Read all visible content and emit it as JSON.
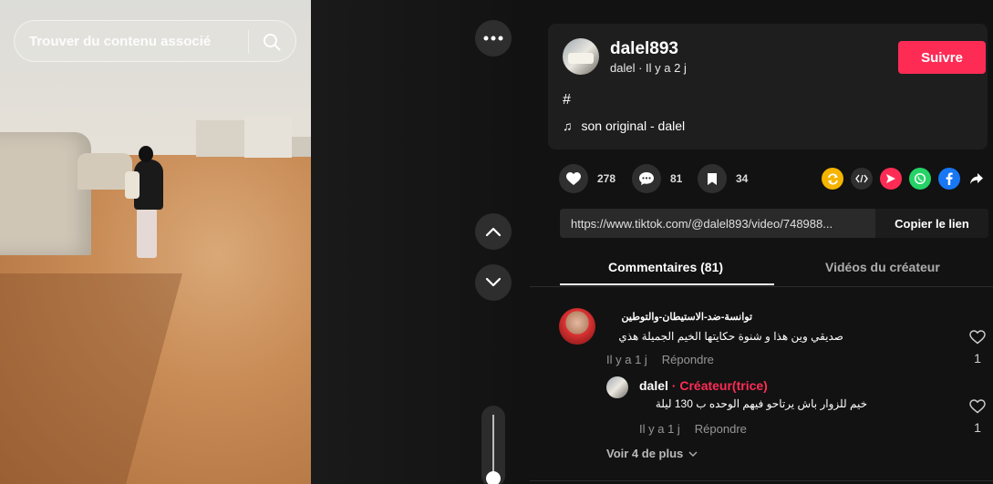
{
  "search": {
    "placeholder": "Trouver du contenu associé"
  },
  "post": {
    "username": "dalel893",
    "nickname": "dalel",
    "time_ago": "Il y a 2 j",
    "follow_label": "Suivre",
    "caption": "#",
    "music": "son original - dalel"
  },
  "actions": {
    "likes": "278",
    "comments": "81",
    "saves": "34"
  },
  "share": {
    "icons": [
      "repost-icon",
      "embed-icon",
      "send-icon",
      "whatsapp-icon",
      "facebook-icon",
      "share-arrow-icon"
    ],
    "colors": {
      "repost": "#f5b400",
      "embed": "#2f2f2f",
      "send": "#fe2c55",
      "whatsapp": "#25d366",
      "facebook": "#1877f2"
    }
  },
  "link": {
    "url": "https://www.tiktok.com/@dalel893/video/748988...",
    "copy_label": "Copier le lien"
  },
  "tabs": {
    "comments": "Commentaires (81)",
    "creator_videos": "Vidéos du créateur"
  },
  "comment": {
    "author": "توانسة-ضد-الاستيطان-والتوطين",
    "text": "صديقي وين هذا و شنوة حكايتها الخيم الجميلة هذي",
    "time": "Il y a 1 j",
    "reply_label": "Répondre",
    "likes": "1"
  },
  "reply": {
    "author": "dalel",
    "badge": "· Créateur(trice)",
    "text": "خيم للزوار باش يرتاحو فيهم الوحده ب 130 ليلة",
    "time": "Il y a 1 j",
    "reply_label": "Répondre",
    "likes": "1"
  },
  "see_more": "Voir 4 de plus",
  "colors": {
    "accent": "#fe2c55",
    "panel": "#1e1e1e",
    "background": "#121212"
  }
}
